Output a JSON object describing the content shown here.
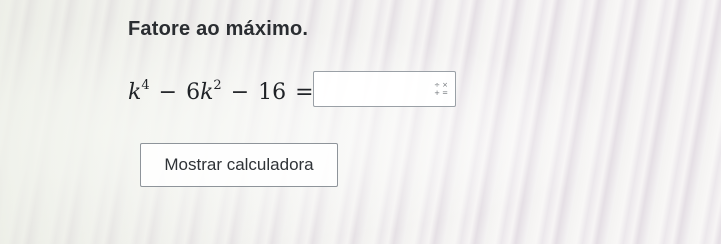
{
  "question": {
    "prompt": "Fatore ao máximo.",
    "equation": {
      "variable": "k",
      "exp1": "4",
      "minus1": "−",
      "coef": "6",
      "exp2": "2",
      "minus2": "−",
      "constant": "16",
      "equals": "="
    },
    "answer_value": "",
    "math_icon_glyphs": [
      "÷",
      "×",
      "+",
      "="
    ]
  },
  "calculator_button": {
    "label": "Mostrar calculadora"
  }
}
